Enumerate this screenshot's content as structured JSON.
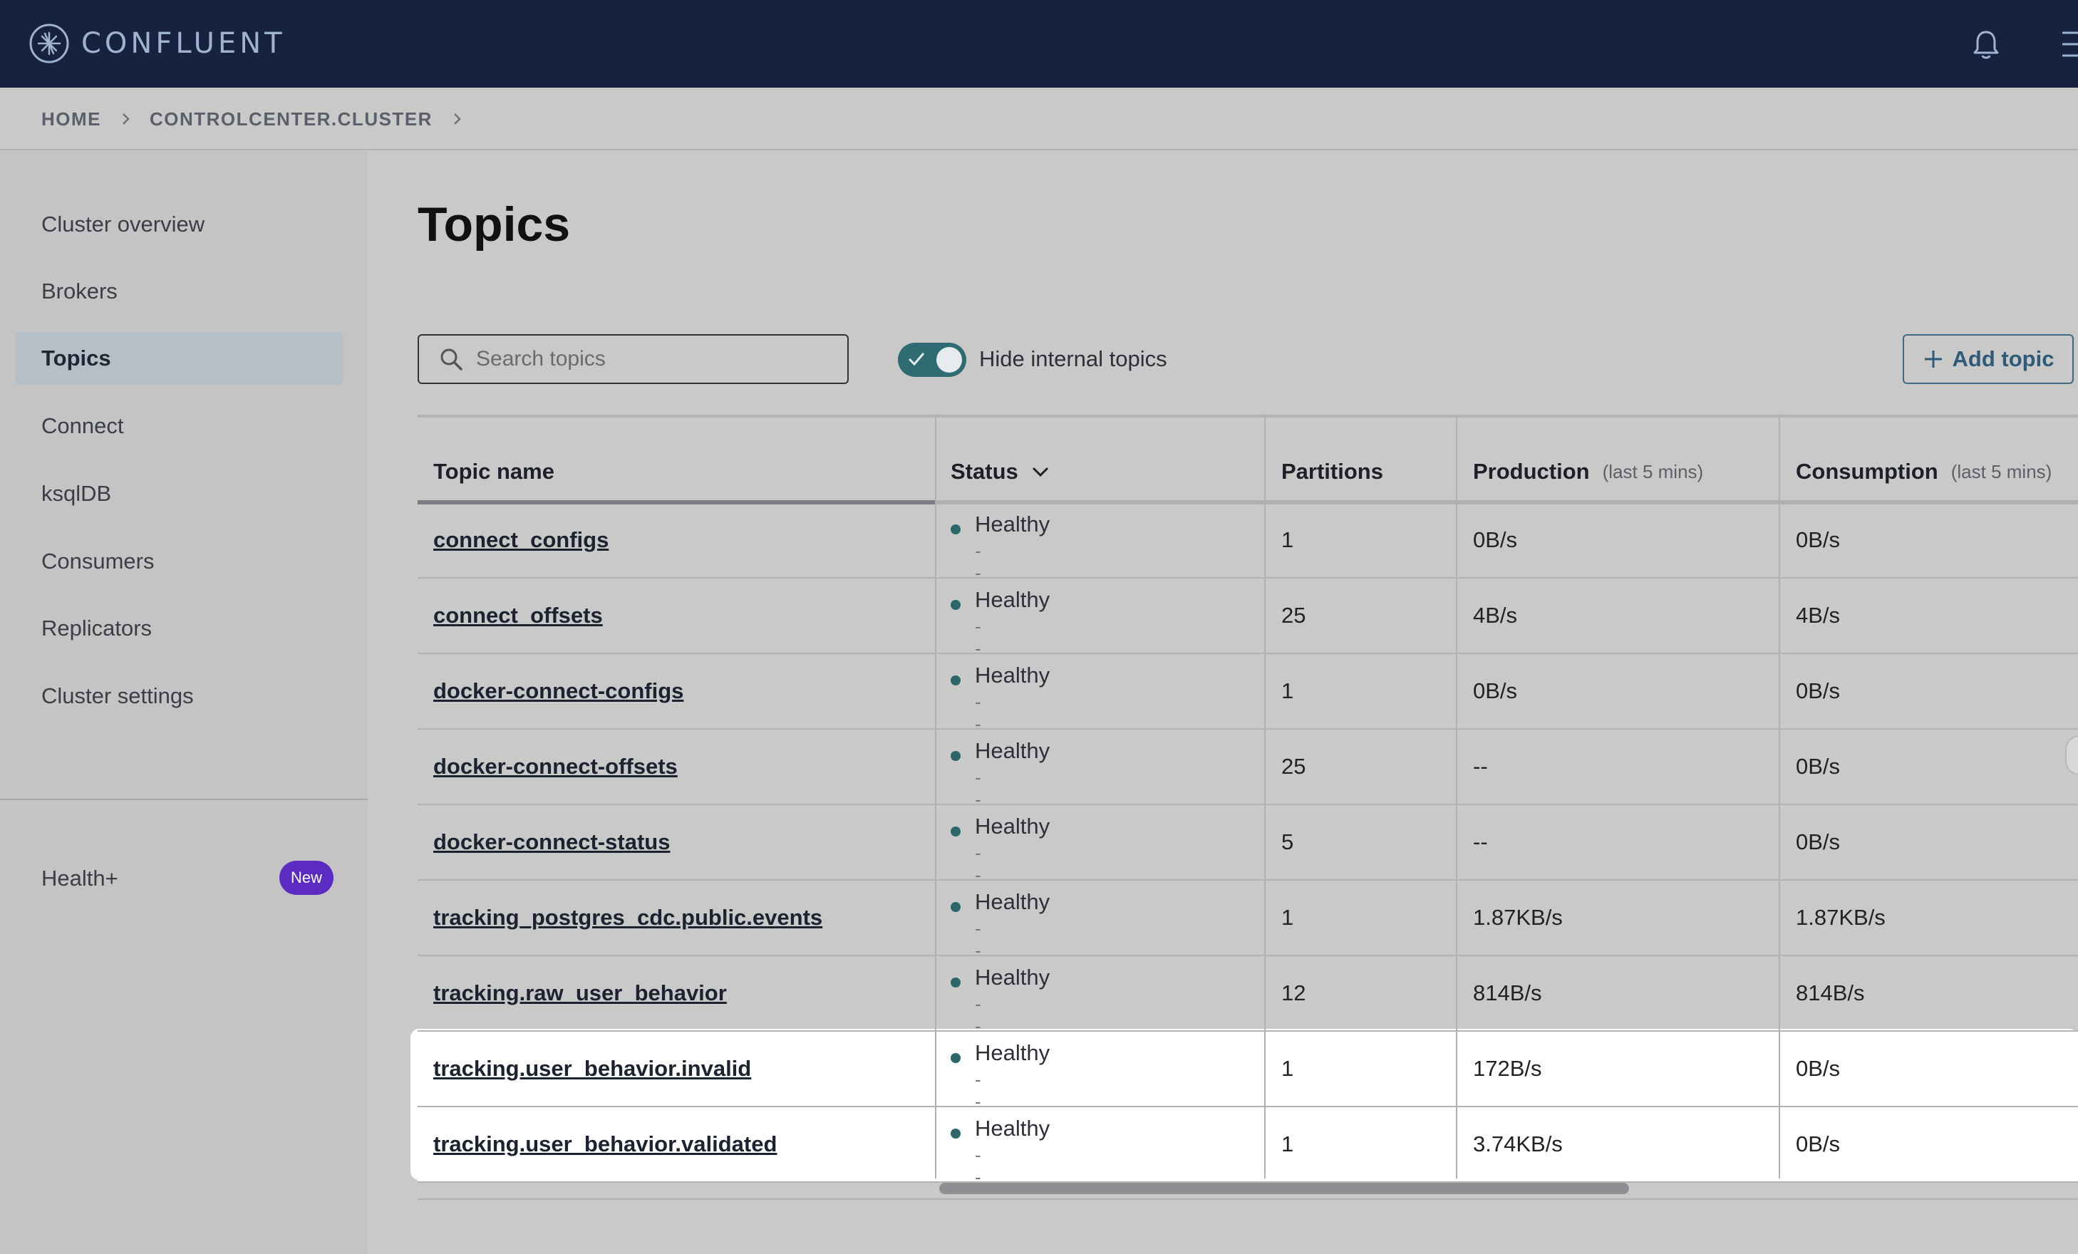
{
  "app": {
    "brand": "CONFLUENT"
  },
  "breadcrumb": {
    "items": [
      "HOME",
      "CONTROLCENTER.CLUSTER"
    ]
  },
  "sidebar": {
    "items": [
      {
        "label": "Cluster overview"
      },
      {
        "label": "Brokers"
      },
      {
        "label": "Topics",
        "active": true
      },
      {
        "label": "Connect"
      },
      {
        "label": "ksqlDB"
      },
      {
        "label": "Consumers"
      },
      {
        "label": "Replicators"
      },
      {
        "label": "Cluster settings"
      }
    ],
    "health": {
      "label": "Health+",
      "badge": "New"
    }
  },
  "main": {
    "title": "Topics",
    "search": {
      "placeholder": "Search topics",
      "value": ""
    },
    "toggle": {
      "label": "Hide internal topics",
      "on": true
    },
    "add_button": "Add topic"
  },
  "table": {
    "columns": [
      {
        "label": "Topic name",
        "sub": ""
      },
      {
        "label": "Status",
        "sub": ""
      },
      {
        "label": "Partitions",
        "sub": ""
      },
      {
        "label": "Production",
        "sub": "(last 5 mins)"
      },
      {
        "label": "Consumption",
        "sub": "(last 5 mins)"
      }
    ],
    "rows": [
      {
        "name": "connect_configs",
        "status": "Healthy",
        "status_sub": "--",
        "partitions": "1",
        "production": "0B/s",
        "consumption": "0B/s"
      },
      {
        "name": "connect_offsets",
        "status": "Healthy",
        "status_sub": "--",
        "partitions": "25",
        "production": "4B/s",
        "consumption": "4B/s"
      },
      {
        "name": "docker-connect-configs",
        "status": "Healthy",
        "status_sub": "--",
        "partitions": "1",
        "production": "0B/s",
        "consumption": "0B/s"
      },
      {
        "name": "docker-connect-offsets",
        "status": "Healthy",
        "status_sub": "--",
        "partitions": "25",
        "production": "--",
        "consumption": "0B/s"
      },
      {
        "name": "docker-connect-status",
        "status": "Healthy",
        "status_sub": "--",
        "partitions": "5",
        "production": "--",
        "consumption": "0B/s"
      },
      {
        "name": "tracking_postgres_cdc.public.events",
        "status": "Healthy",
        "status_sub": "--",
        "partitions": "1",
        "production": "1.87KB/s",
        "consumption": "1.87KB/s"
      },
      {
        "name": "tracking.raw_user_behavior",
        "status": "Healthy",
        "status_sub": "--",
        "partitions": "12",
        "production": "814B/s",
        "consumption": "814B/s"
      },
      {
        "name": "tracking.user_behavior.invalid",
        "status": "Healthy",
        "status_sub": "--",
        "partitions": "1",
        "production": "172B/s",
        "consumption": "0B/s"
      },
      {
        "name": "tracking.user_behavior.validated",
        "status": "Healthy",
        "status_sub": "--",
        "partitions": "1",
        "production": "3.74KB/s",
        "consumption": "0B/s"
      }
    ]
  },
  "colors": {
    "topbar": "#162240",
    "accent": "#2e6b73",
    "badge": "#5b2bc2",
    "status_healthy": "#2b6768"
  }
}
